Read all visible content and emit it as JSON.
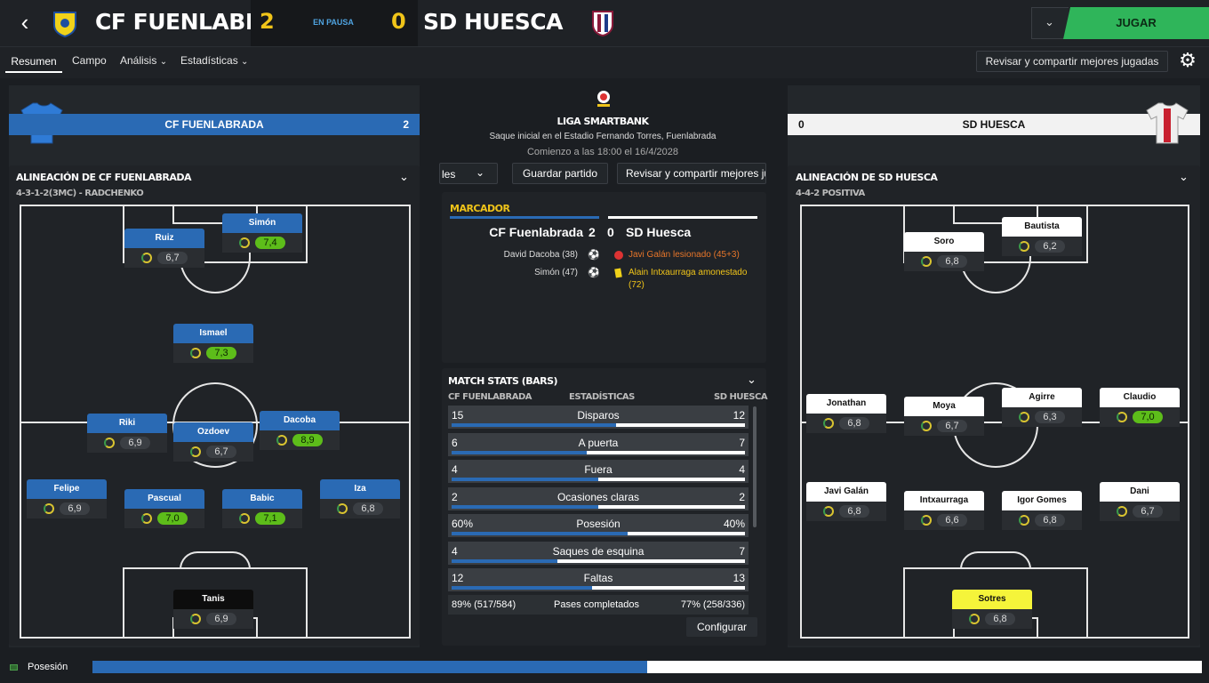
{
  "header": {
    "home_name": "CF FUENLABRADA",
    "home_score": "2",
    "status": "EN PAUSA",
    "away_score": "0",
    "away_name": "SD HUESCA",
    "play_label": "JUGAR"
  },
  "tabs": {
    "resumen": "Resumen",
    "campo": "Campo",
    "analisis": "Análisis",
    "estadisticas": "Estadísticas",
    "review": "Revisar y compartir mejores jugadas"
  },
  "home": {
    "banner": "CF FUENLABRADA",
    "score": "2",
    "lineup_title": "ALINEACIÓN DE CF FUENLABRADA",
    "formation": "4-3-1-2(3MC) - RADCHENKO",
    "players": [
      {
        "name": "Ruiz",
        "rating": "6,7",
        "green": false,
        "style": "blue"
      },
      {
        "name": "Simón",
        "rating": "7,4",
        "green": true,
        "style": "blue"
      },
      {
        "name": "Ismael",
        "rating": "7,3",
        "green": true,
        "style": "blue"
      },
      {
        "name": "Riki",
        "rating": "6,9",
        "green": false,
        "style": "blue"
      },
      {
        "name": "Ozdoev",
        "rating": "6,7",
        "green": false,
        "style": "blue"
      },
      {
        "name": "Dacoba",
        "rating": "8,9",
        "green": true,
        "style": "blue"
      },
      {
        "name": "Felipe",
        "rating": "6,9",
        "green": false,
        "style": "blue"
      },
      {
        "name": "Pascual",
        "rating": "7,0",
        "green": true,
        "style": "blue"
      },
      {
        "name": "Babic",
        "rating": "7,1",
        "green": true,
        "style": "blue"
      },
      {
        "name": "Iza",
        "rating": "6,8",
        "green": false,
        "style": "blue"
      },
      {
        "name": "Tanis",
        "rating": "6,9",
        "green": false,
        "style": "black"
      }
    ]
  },
  "away": {
    "banner": "SD HUESCA",
    "score": "0",
    "lineup_title": "ALINEACIÓN DE SD HUESCA",
    "formation": "4-4-2 POSITIVA",
    "players": [
      {
        "name": "Soro",
        "rating": "6,8",
        "green": false,
        "style": "white"
      },
      {
        "name": "Bautista",
        "rating": "6,2",
        "green": false,
        "style": "white"
      },
      {
        "name": "Jonathan",
        "rating": "6,8",
        "green": false,
        "style": "white"
      },
      {
        "name": "Moya",
        "rating": "6,7",
        "green": false,
        "style": "white"
      },
      {
        "name": "Agirre",
        "rating": "6,3",
        "green": false,
        "style": "white"
      },
      {
        "name": "Claudio",
        "rating": "7,0",
        "green": true,
        "style": "white"
      },
      {
        "name": "Javi Galán",
        "rating": "6,8",
        "green": false,
        "style": "white"
      },
      {
        "name": "Intxaurraga",
        "rating": "6,6",
        "green": false,
        "style": "white"
      },
      {
        "name": "Igor Gomes",
        "rating": "6,8",
        "green": false,
        "style": "white"
      },
      {
        "name": "Dani",
        "rating": "6,7",
        "green": false,
        "style": "white"
      },
      {
        "name": "Sotres",
        "rating": "6,8",
        "green": false,
        "style": "yellow"
      }
    ]
  },
  "center": {
    "league": "LIGA SMARTBANK",
    "kickoff": "Saque inicial en el Estadio Fernando Torres, Fuenlabrada",
    "start": "Comienzo a las 18:00 el 16/4/2028",
    "dropdown": "les",
    "save": "Guardar partido",
    "review": "Revisar y compartir mejores ju",
    "marcador": "MARCADOR",
    "home_team": "CF Fuenlabrada",
    "home_goals": "2",
    "away_goals": "0",
    "away_team": "SD Huesca",
    "events_home": [
      "David Dacoba (38)",
      "Simón (47)"
    ],
    "event_injury": "Javi Galán lesionado (45+3)",
    "event_card_a": "Alain Intxaurraga amonestado",
    "event_card_b": "(72)",
    "stats_title": "MATCH STATS (BARS)",
    "col_home": "CF FUENLABRADA",
    "col_mid": "ESTADÍSTICAS",
    "col_away": "SD HUESCA",
    "stats": [
      {
        "h": "15",
        "label": "Disparos",
        "a": "12",
        "hf": 0.56
      },
      {
        "h": "6",
        "label": "A puerta",
        "a": "7",
        "hf": 0.46
      },
      {
        "h": "4",
        "label": "Fuera",
        "a": "4",
        "hf": 0.5
      },
      {
        "h": "2",
        "label": "Ocasiones claras",
        "a": "2",
        "hf": 0.5
      },
      {
        "h": "60%",
        "label": "Posesión",
        "a": "40%",
        "hf": 0.6
      },
      {
        "h": "4",
        "label": "Saques de esquina",
        "a": "7",
        "hf": 0.36
      },
      {
        "h": "12",
        "label": "Faltas",
        "a": "13",
        "hf": 0.48
      }
    ],
    "passes": {
      "h": "89% (517/584)",
      "label": "Pases completados",
      "a": "77% (258/336)"
    },
    "configure": "Configurar"
  },
  "footer": {
    "label": "Posesión",
    "home_possession": 0.5
  },
  "colors": {
    "home_blue": "#2a6ab4",
    "play_green": "#2fb55a",
    "score_yellow": "#f0c419"
  }
}
